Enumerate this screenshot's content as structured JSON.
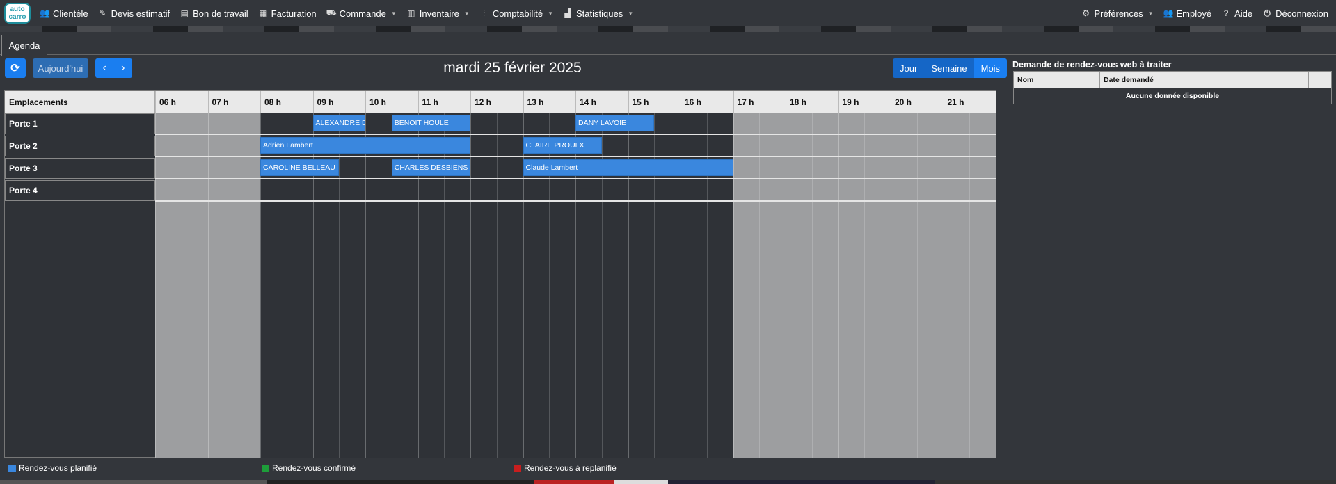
{
  "logo": {
    "line1": "auto",
    "line2": "carro"
  },
  "nav": {
    "left": [
      {
        "label": "Clientèle",
        "icon": "users-icon",
        "dropdown": false
      },
      {
        "label": "Devis estimatif",
        "icon": "edit-document-icon",
        "dropdown": false
      },
      {
        "label": "Bon de travail",
        "icon": "document-icon",
        "dropdown": false
      },
      {
        "label": "Facturation",
        "icon": "invoice-icon",
        "dropdown": false
      },
      {
        "label": "Commande",
        "icon": "basket-icon",
        "dropdown": true
      },
      {
        "label": "Inventaire",
        "icon": "inventory-icon",
        "dropdown": true
      },
      {
        "label": "Comptabilité",
        "icon": "accounting-icon",
        "dropdown": true
      },
      {
        "label": "Statistiques",
        "icon": "chart-icon",
        "dropdown": true
      }
    ],
    "right": [
      {
        "label": "Préférences",
        "icon": "gear-icon",
        "dropdown": true
      },
      {
        "label": "Employé",
        "icon": "users-icon",
        "dropdown": false
      },
      {
        "label": "Aide",
        "icon": "question-icon",
        "dropdown": false
      },
      {
        "label": "Déconnexion",
        "icon": "power-icon",
        "dropdown": false
      }
    ]
  },
  "tab": {
    "label": "Agenda"
  },
  "toolbar": {
    "today_label": "Aujourd'hui",
    "date_title": "mardi 25 février 2025",
    "views": [
      "Jour",
      "Semaine",
      "Mois"
    ]
  },
  "scheduler": {
    "resource_header": "Emplacements",
    "resources": [
      "Porte 1",
      "Porte 2",
      "Porte 3",
      "Porte 4"
    ],
    "hours": [
      "06 h",
      "07 h",
      "08 h",
      "09 h",
      "10 h",
      "11 h",
      "12 h",
      "13 h",
      "14 h",
      "15 h",
      "16 h",
      "17 h",
      "18 h",
      "19 h",
      "20 h",
      "21 h"
    ],
    "working_hours": {
      "start": 8,
      "end": 17
    },
    "events": [
      {
        "resource": 0,
        "start": 9.0,
        "end": 10.0,
        "label": "ALEXANDRE DE"
      },
      {
        "resource": 0,
        "start": 10.5,
        "end": 12.0,
        "label": "BENOIT HOULE"
      },
      {
        "resource": 0,
        "start": 14.0,
        "end": 15.5,
        "label": "DANY LAVOIE"
      },
      {
        "resource": 1,
        "start": 8.0,
        "end": 12.0,
        "label": "Adrien Lambert"
      },
      {
        "resource": 1,
        "start": 13.0,
        "end": 14.5,
        "label": "CLAIRE PROULX"
      },
      {
        "resource": 2,
        "start": 8.0,
        "end": 9.5,
        "label": "CAROLINE BELLEAU"
      },
      {
        "resource": 2,
        "start": 10.5,
        "end": 12.0,
        "label": "CHARLES DESBIENS"
      },
      {
        "resource": 2,
        "start": 13.0,
        "end": 17.0,
        "label": "Claude Lambert"
      }
    ]
  },
  "legend": [
    {
      "label": "Rendez-vous planifié",
      "color": "#3a87de"
    },
    {
      "label": "Rendez-vous confirmé",
      "color": "#1e9e3a"
    },
    {
      "label": "Rendez-vous à replanifié",
      "color": "#c81e1e"
    }
  ],
  "web_requests": {
    "title": "Demande de rendez-vous web à traiter",
    "columns": [
      "Nom",
      "Date demandé",
      ""
    ],
    "empty_text": "Aucune donnée disponible"
  }
}
